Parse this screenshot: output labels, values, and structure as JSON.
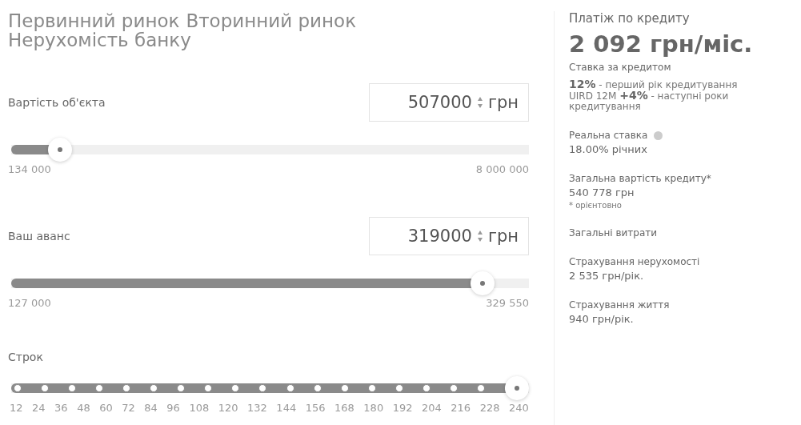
{
  "tabs": [
    {
      "label": "Первинний ринок",
      "selected": false
    },
    {
      "label": "Вторинний ринок",
      "selected": false
    },
    {
      "label": "Нерухомість банку",
      "selected": false
    }
  ],
  "fields": [
    {
      "label": "Вартість об'єкта",
      "value": "507000",
      "unit": "грн",
      "level": 0.075,
      "min": "134 000",
      "max": "8 000 000"
    },
    {
      "label": "Ваш аванс",
      "value": "319000",
      "unit": "грн",
      "level": 0.93,
      "min": "127 000",
      "max": "329 550"
    }
  ],
  "term": {
    "label": "Строк",
    "level": 1,
    "ticks": [
      "12",
      "24",
      "36",
      "48",
      "60",
      "72",
      "84",
      "96",
      "108",
      "120",
      "132",
      "144",
      "156",
      "168",
      "180",
      "192",
      "204",
      "216",
      "228",
      "240"
    ]
  },
  "summary": {
    "title": "Платіж по кредиту",
    "payment": "2 092 грн/міс.",
    "rate_label": "Ставка за кредитом",
    "rate_lines": [
      "**12%** - перший рік кредитування",
      "UIRD 12M **+4%** - наступні роки кредитування"
    ],
    "items": [
      {
        "label": "Реальна ставка",
        "value": "18.00% річних",
        "info": true
      },
      {
        "label": "Загальна вартість кредиту*",
        "value": "540 778 грн",
        "note": "* орієнтовно",
        "info": false
      },
      {
        "label": "Загальні витрати",
        "info": false
      },
      {
        "label": "Страхування нерухомості",
        "value": "2 535 грн/рік.",
        "info": false
      },
      {
        "label": "Страхування життя",
        "value": "940 грн/рік.",
        "info": false
      }
    ]
  }
}
